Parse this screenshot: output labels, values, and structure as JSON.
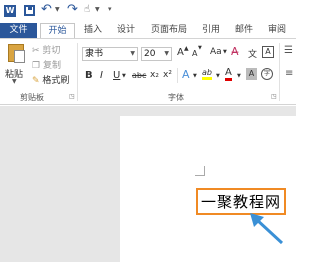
{
  "qat": {
    "word_icon": "word-logo",
    "save_icon": "save-icon",
    "undo_icon": "undo-icon",
    "redo_icon": "redo-icon",
    "touch_icon": "touch-mode-icon",
    "customize_icon": "customize-qat-icon"
  },
  "tabs": [
    {
      "label": "文件"
    },
    {
      "label": "开始"
    },
    {
      "label": "插入"
    },
    {
      "label": "设计"
    },
    {
      "label": "页面布局"
    },
    {
      "label": "引用"
    },
    {
      "label": "邮件"
    },
    {
      "label": "审阅"
    }
  ],
  "clipboard": {
    "paste_label": "粘贴",
    "cut_label": "剪切",
    "copy_label": "复制",
    "format_painter_label": "格式刷",
    "group_label": "剪贴板"
  },
  "font": {
    "font_name": "隶书",
    "font_size": "20",
    "group_label": "字体",
    "grow_label": "A",
    "shrink_label": "A",
    "case_label": "Aa",
    "phonetic_label": "文",
    "border_label": "A",
    "bold_label": "B",
    "italic_label": "I",
    "underline_label": "U",
    "strike_label": "abc",
    "subscript_label": "x₂",
    "superscript_label": "x²",
    "effects_label": "A",
    "highlight_label": "ab",
    "color_label": "A",
    "shade_label": "A",
    "circle_label": "字",
    "highlight_color": "#ffff00",
    "font_color": "#e00000"
  },
  "document": {
    "selected_text": "一聚教程网",
    "selection_border_color": "#f08a24",
    "arrow_color": "#3a90d6"
  }
}
